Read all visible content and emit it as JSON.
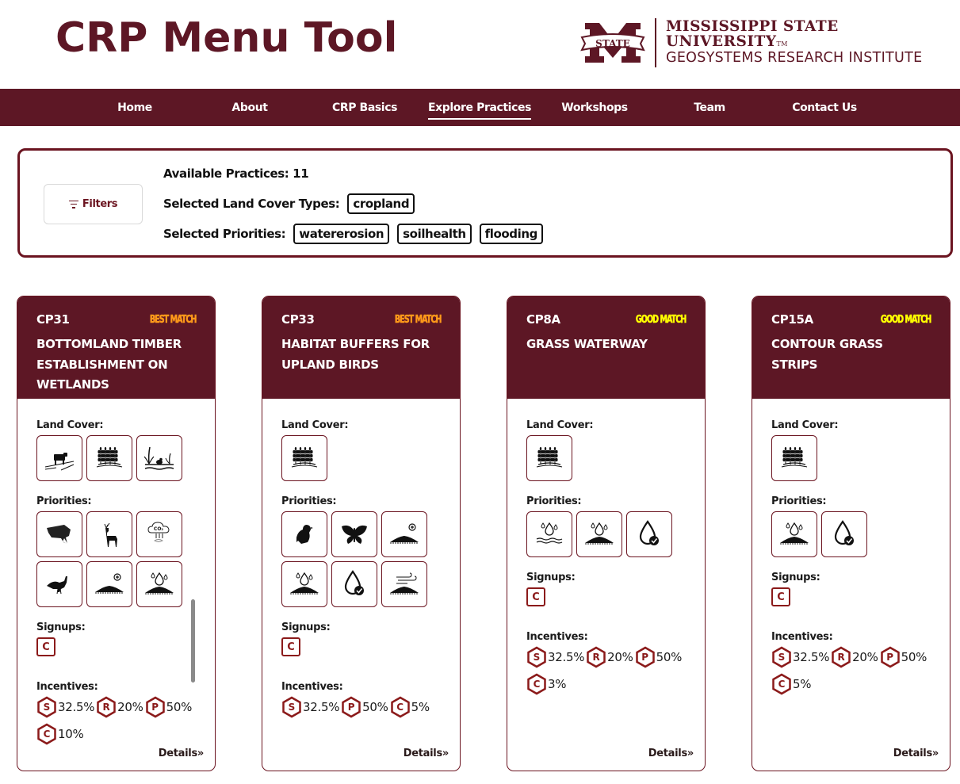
{
  "header": {
    "title": "CRP Menu Tool",
    "logo_line1": "MISSISSIPPI STATE UNIVERSITY",
    "logo_tm": "TM",
    "logo_line2": "GEOSYSTEMS RESEARCH INSTITUTE",
    "logo_mark_text": "STATE"
  },
  "nav": {
    "items": [
      {
        "label": "Home"
      },
      {
        "label": "About"
      },
      {
        "label": "CRP Basics"
      },
      {
        "label": "Explore Practices",
        "active": true
      },
      {
        "label": "Workshops"
      },
      {
        "label": "Team"
      },
      {
        "label": "Contact Us"
      }
    ]
  },
  "filters": {
    "button_label": "Filters",
    "available_label": "Available Practices: 11",
    "land_cover_label": "Selected Land Cover Types:",
    "land_cover_chips": [
      "cropland"
    ],
    "priorities_label": "Selected Priorities:",
    "priority_chips": [
      "watererosion",
      "soilhealth",
      "flooding"
    ]
  },
  "labels": {
    "land_cover": "Land Cover:",
    "priorities": "Priorities:",
    "signups": "Signups:",
    "incentives": "Incentives:",
    "details": "Details",
    "details_arrow": "»"
  },
  "colors": {
    "brand": "#5d1725",
    "best_match": "#ff9a1a",
    "good_match": "#ffff00"
  },
  "cards": [
    {
      "code": "CP31",
      "match": "BEST MATCH",
      "match_type": "best",
      "name": "BOTTOMLAND TIMBER ESTABLISHMENT ON WETLANDS",
      "land_cover_icons": [
        "livestock-pasture-icon",
        "cropland-wheat-icon",
        "wetland-frog-icon"
      ],
      "priority_icons": [
        "fish-icon",
        "deer-icon",
        "carbon-sequestration-icon",
        "turkey-icon",
        "soil-health-icon",
        "water-erosion-soil-icon"
      ],
      "signups": [
        "C"
      ],
      "incentives": [
        {
          "letter": "S",
          "value": "32.5%"
        },
        {
          "letter": "R",
          "value": "20%"
        },
        {
          "letter": "P",
          "value": "50%"
        },
        {
          "letter": "C",
          "value": "10%"
        }
      ],
      "has_scrollbar": true
    },
    {
      "code": "CP33",
      "match": "BEST MATCH",
      "match_type": "best",
      "name": "HABITAT BUFFERS FOR UPLAND BIRDS",
      "land_cover_icons": [
        "cropland-wheat-icon"
      ],
      "priority_icons": [
        "quail-icon",
        "butterfly-icon",
        "soil-health-icon",
        "water-erosion-soil-icon",
        "water-quality-icon",
        "wind-erosion-icon"
      ],
      "signups": [
        "C"
      ],
      "incentives": [
        {
          "letter": "S",
          "value": "32.5%"
        },
        {
          "letter": "P",
          "value": "50%"
        },
        {
          "letter": "C",
          "value": "5%"
        }
      ]
    },
    {
      "code": "CP8A",
      "match": "GOOD MATCH",
      "match_type": "good",
      "name": "GRASS WATERWAY",
      "land_cover_icons": [
        "cropland-wheat-icon"
      ],
      "priority_icons": [
        "flooding-icon",
        "water-erosion-soil-icon",
        "water-quality-icon"
      ],
      "signups": [
        "C"
      ],
      "incentives": [
        {
          "letter": "S",
          "value": "32.5%"
        },
        {
          "letter": "R",
          "value": "20%"
        },
        {
          "letter": "P",
          "value": "50%"
        },
        {
          "letter": "C",
          "value": "3%"
        }
      ]
    },
    {
      "code": "CP15A",
      "match": "GOOD MATCH",
      "match_type": "good",
      "name": "CONTOUR GRASS STRIPS",
      "land_cover_icons": [
        "cropland-wheat-icon"
      ],
      "priority_icons": [
        "water-erosion-soil-icon",
        "water-quality-icon"
      ],
      "signups": [
        "C"
      ],
      "incentives": [
        {
          "letter": "S",
          "value": "32.5%"
        },
        {
          "letter": "R",
          "value": "20%"
        },
        {
          "letter": "P",
          "value": "50%"
        },
        {
          "letter": "C",
          "value": "5%"
        }
      ]
    }
  ]
}
